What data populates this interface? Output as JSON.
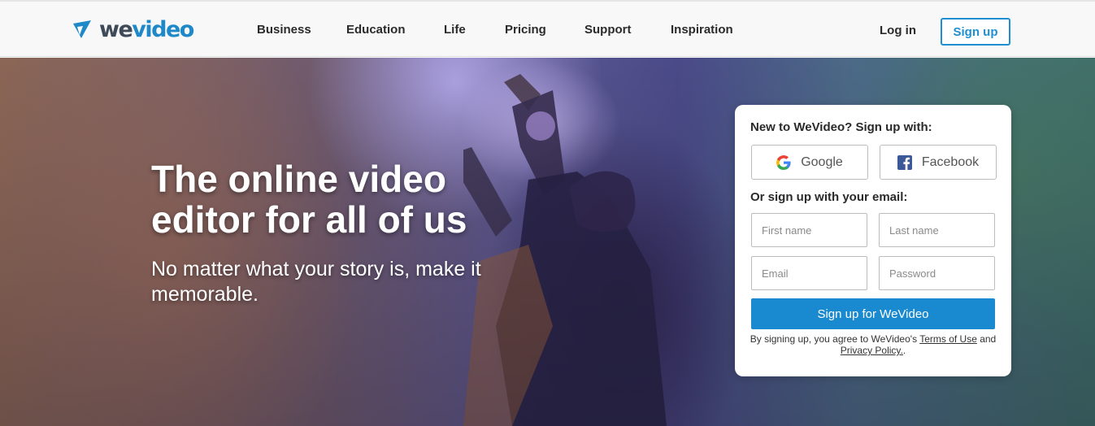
{
  "brand": {
    "logo_text_we": "we",
    "logo_text_video": "video",
    "colors": {
      "accent": "#1e8fd0",
      "dark": "#3f4a59"
    }
  },
  "nav": {
    "items": [
      {
        "label": "Business"
      },
      {
        "label": "Education"
      },
      {
        "label": "Life"
      },
      {
        "label": "Pricing"
      },
      {
        "label": "Support"
      },
      {
        "label": "Inspiration"
      }
    ],
    "login_label": "Log in",
    "signup_label": "Sign up"
  },
  "hero": {
    "headline": "The online video editor for all of us",
    "subline": "No matter what your story is, make it memorable."
  },
  "signup_card": {
    "title": "New to WeVideo? Sign up with:",
    "google_label": "Google",
    "facebook_label": "Facebook",
    "or_email_label": "Or sign up with your email:",
    "fields": {
      "first_name_placeholder": "First name",
      "last_name_placeholder": "Last name",
      "email_placeholder": "Email",
      "password_placeholder": "Password"
    },
    "submit_label": "Sign up for WeVideo",
    "legal": {
      "prefix": "By signing up, you agree to WeVideo's ",
      "terms_label": "Terms of Use",
      "and": " and ",
      "privacy_label": "Privacy Policy.",
      "suffix": "."
    }
  },
  "icons": [
    "wevideo-logo-icon",
    "google-icon",
    "facebook-icon"
  ]
}
